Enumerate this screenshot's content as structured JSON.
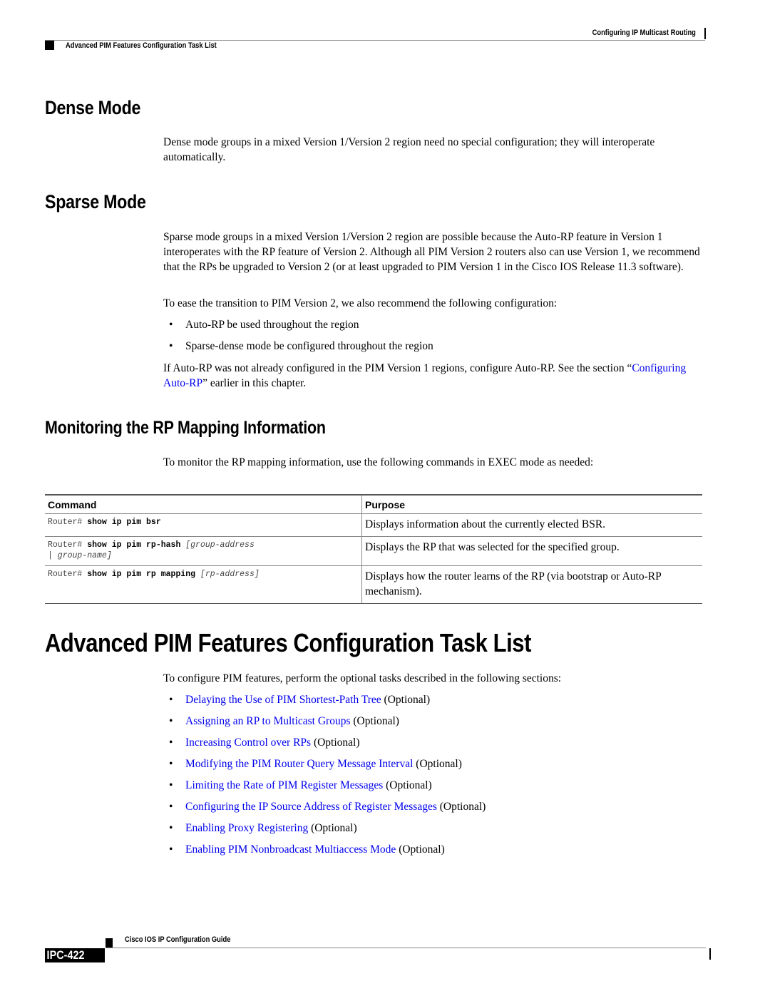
{
  "header": {
    "chapter_title": "Configuring IP Multicast Routing",
    "section_title": "Advanced PIM Features Configuration Task List"
  },
  "dense_mode": {
    "heading": "Dense Mode",
    "body": "Dense mode groups in a mixed Version 1/Version 2 region need no special configuration; they will interoperate automatically."
  },
  "sparse_mode": {
    "heading": "Sparse Mode",
    "body": "Sparse mode groups in a mixed Version 1/Version 2 region are possible because the Auto-RP feature in Version 1 interoperates with the RP feature of Version 2. Although all PIM Version 2 routers also can use Version 1, we recommend that the RPs be upgraded to Version 2 (or at least upgraded to PIM Version 1 in the Cisco IOS Release 11.3 software).",
    "intro": "To ease the transition to PIM Version 2, we also recommend the following configuration:",
    "bullets": [
      "Auto-RP be used throughout the region",
      "Sparse-dense mode be configured throughout the region"
    ],
    "closing_pre": "If Auto-RP was not already configured in the PIM Version 1 regions, configure Auto-RP. See the section “",
    "closing_link": "Configuring Auto-RP",
    "closing_post": "” earlier in this chapter."
  },
  "monitoring": {
    "heading": "Monitoring the RP Mapping Information",
    "intro": "To monitor the RP mapping information, use the following commands in EXEC mode as needed:",
    "table": {
      "headers": [
        "Command",
        "Purpose"
      ],
      "rows": [
        {
          "prompt": "Router# ",
          "keyword": "show ip pim bsr",
          "args": "",
          "args2": "",
          "purpose": "Displays information about the currently elected BSR."
        },
        {
          "prompt": "Router# ",
          "keyword": "show ip pim rp-hash",
          "args": " [group-address",
          "args2": "| group-name]",
          "purpose": "Displays the RP that was selected for the specified group."
        },
        {
          "prompt": "Router# ",
          "keyword": "show ip pim rp mapping",
          "args": " [rp-address]",
          "args2": "",
          "purpose": "Displays how the router learns of the RP (via bootstrap or Auto-RP mechanism)."
        }
      ]
    }
  },
  "advanced": {
    "heading": "Advanced PIM Features Configuration Task List",
    "intro": "To configure PIM features, perform the optional tasks described in the following sections:",
    "tasks": [
      {
        "link": "Delaying the Use of PIM Shortest-Path Tree",
        "suffix": " (Optional)"
      },
      {
        "link": "Assigning an RP to Multicast Groups",
        "suffix": " (Optional)"
      },
      {
        "link": "Increasing Control over RPs",
        "suffix": " (Optional)"
      },
      {
        "link": "Modifying the PIM Router Query Message Interval",
        "suffix": " (Optional)"
      },
      {
        "link": "Limiting the Rate of PIM Register Messages",
        "suffix": " (Optional)"
      },
      {
        "link": "Configuring the IP Source Address of Register Messages",
        "suffix": " (Optional)"
      },
      {
        "link": "Enabling Proxy Registering",
        "suffix": " (Optional)"
      },
      {
        "link": "Enabling PIM Nonbroadcast Multiaccess Mode",
        "suffix": " (Optional)"
      }
    ]
  },
  "footer": {
    "guide_title": "Cisco IOS IP Configuration Guide",
    "page_number": "IPC-422"
  },
  "colors": {
    "link": "#0000ee",
    "text": "#000000"
  }
}
